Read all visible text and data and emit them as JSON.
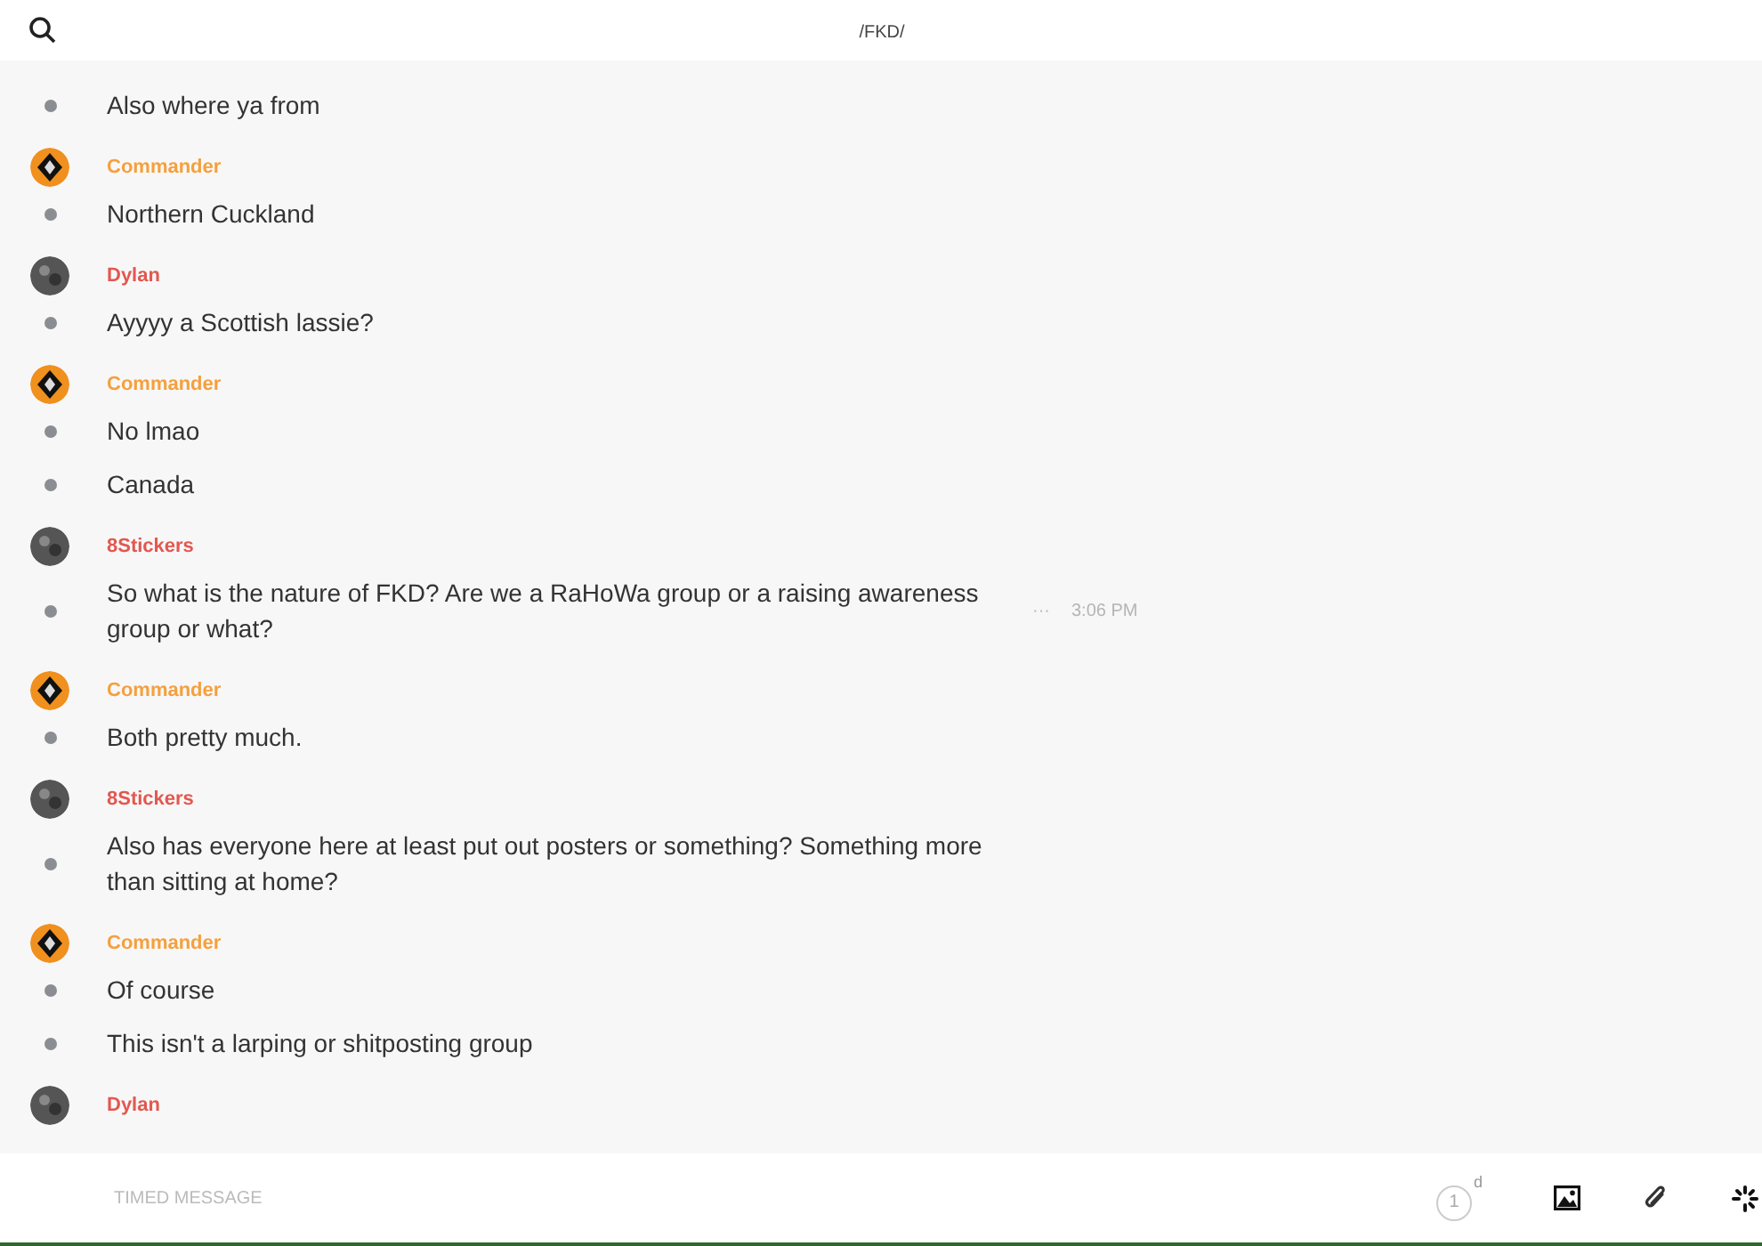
{
  "top_bar": {
    "title": "/FKD/"
  },
  "groups": [
    {
      "messages": [
        {
          "text": "Also where ya from"
        }
      ]
    },
    {
      "author": "Commander",
      "color": "#f5a03c",
      "kind": "emblem",
      "messages": [
        {
          "text": "Northern Cuckland"
        }
      ]
    },
    {
      "author": "Dylan",
      "color": "#e2584f",
      "kind": "photo",
      "messages": [
        {
          "text": "Ayyyy a Scottish lassie?"
        }
      ]
    },
    {
      "author": "Commander",
      "color": "#f5a03c",
      "kind": "emblem",
      "messages": [
        {
          "text": "No lmao"
        },
        {
          "text": "Canada"
        }
      ]
    },
    {
      "author": "8Stickers",
      "color": "#e2584f",
      "kind": "photo",
      "messages": [
        {
          "text": "So what is the nature of FKD? Are we a RaHoWa group or a raising awareness group or what?",
          "more": "···",
          "time": "3:06 PM"
        }
      ]
    },
    {
      "author": "Commander",
      "color": "#f5a03c",
      "kind": "emblem",
      "messages": [
        {
          "text": "Both pretty much."
        }
      ]
    },
    {
      "author": "8Stickers",
      "color": "#e2584f",
      "kind": "photo",
      "messages": [
        {
          "text": "Also has everyone here at least put out posters or something? Something more than sitting at home?"
        }
      ]
    },
    {
      "author": "Commander",
      "color": "#f5a03c",
      "kind": "emblem",
      "messages": [
        {
          "text": "Of course"
        },
        {
          "text": "This isn't a larping or shitposting group"
        }
      ]
    },
    {
      "author": "Dylan",
      "color": "#e2584f",
      "kind": "photo"
    }
  ],
  "composer": {
    "placeholder": "TIMED MESSAGE",
    "timer_count": "1",
    "timer_unit": "d"
  }
}
